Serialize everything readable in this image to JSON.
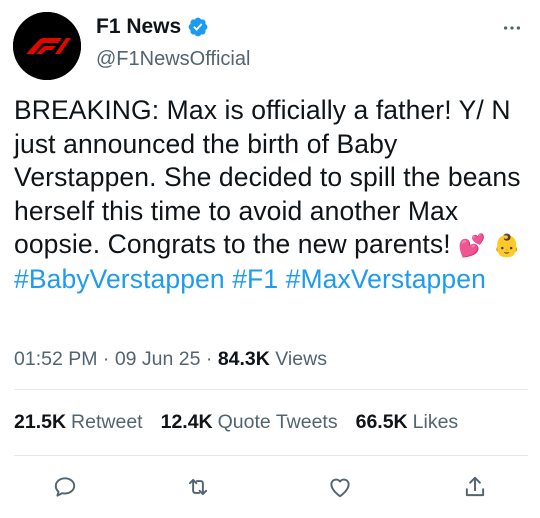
{
  "user": {
    "display_name": "F1 News",
    "handle": "@F1NewsOfficial"
  },
  "tweet": {
    "text_main": "BREAKING: Max is officially a father! Y/ N just announced the birth of Baby Verstappen. She decided to spill the beans herself this time to avoid another Max oopsie. Congrats to the new parents!",
    "emoji_1": "💕",
    "emoji_2": "👶",
    "hashtags": [
      "#BabyVerstappen",
      "#F1",
      "#MaxVerstappen"
    ]
  },
  "meta": {
    "time": "01:52 PM",
    "separator": "·",
    "date": "09 Jun 25",
    "views_count": "84.3K",
    "views_label": "Views"
  },
  "stats": {
    "retweets_count": "21.5K",
    "retweets_label": "Retweet",
    "quotes_count": "12.4K",
    "quotes_label": "Quote Tweets",
    "likes_count": "66.5K",
    "likes_label": "Likes"
  },
  "icons": {
    "reply": "reply-icon",
    "retweet": "retweet-icon",
    "like": "heart-icon",
    "share": "share-icon",
    "verified": "verified-badge-icon",
    "more": "more-options-icon"
  },
  "colors": {
    "accent": "#1d9bf0",
    "secondary_text": "#536471",
    "logo_red": "#e10600"
  }
}
